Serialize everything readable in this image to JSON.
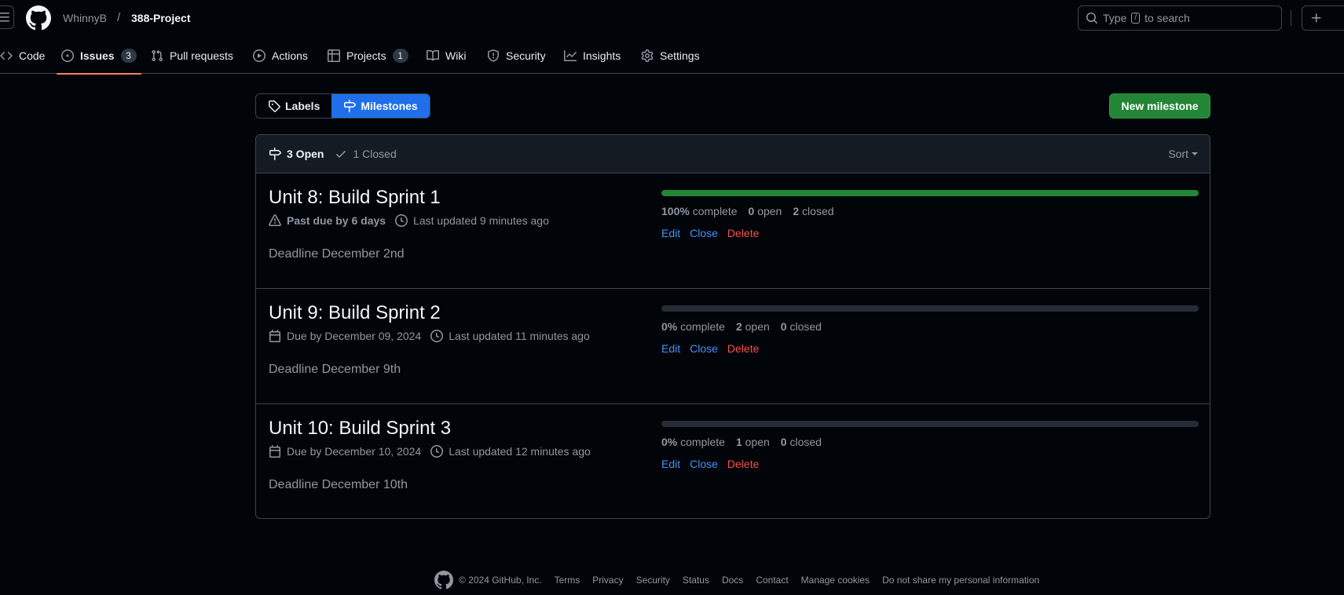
{
  "header": {
    "owner": "WhinnyB",
    "separator": "/",
    "repo": "388-Project",
    "search_placeholder": "Type",
    "search_key": "/",
    "search_suffix": "to search",
    "plus_label": "+"
  },
  "nav": {
    "tabs": [
      {
        "label": "Code",
        "icon": "code-icon"
      },
      {
        "label": "Issues",
        "icon": "issue-opened-icon",
        "counter": "3"
      },
      {
        "label": "Pull requests",
        "icon": "git-pull-request-icon"
      },
      {
        "label": "Actions",
        "icon": "play-icon"
      },
      {
        "label": "Projects",
        "icon": "table-icon",
        "counter": "1"
      },
      {
        "label": "Wiki",
        "icon": "book-icon"
      },
      {
        "label": "Security",
        "icon": "shield-icon"
      },
      {
        "label": "Insights",
        "icon": "graph-icon"
      },
      {
        "label": "Settings",
        "icon": "gear-icon"
      }
    ]
  },
  "subnav": {
    "labels": "Labels",
    "milestones": "Milestones",
    "new_milestone": "New milestone"
  },
  "list": {
    "open_count": "3 Open",
    "closed_count": "1 Closed",
    "sort": "Sort"
  },
  "milestones": [
    {
      "title": "Unit 8: Build Sprint 1",
      "due": "Past due by 6 days",
      "updated": "Last updated 9 minutes ago",
      "description": "Deadline December 2nd",
      "progress": 1.0,
      "percent": "100%",
      "complete_label": "complete",
      "open": "0",
      "open_label": "open",
      "closed": "2",
      "closed_label": "closed"
    },
    {
      "title": "Unit 9: Build Sprint 2",
      "due": "Due by December 09, 2024",
      "updated": "Last updated 11 minutes ago",
      "description": "Deadline December 9th",
      "progress": 0.0,
      "percent": "0%",
      "complete_label": "complete",
      "open": "2",
      "open_label": "open",
      "closed": "0",
      "closed_label": "closed"
    },
    {
      "title": "Unit 10: Build Sprint 3",
      "due": "Due by December 10, 2024",
      "updated": "Last updated 12 minutes ago",
      "description": "Deadline December 10th",
      "progress": 0.0,
      "percent": "0%",
      "complete_label": "complete",
      "open": "1",
      "open_label": "open",
      "closed": "0",
      "closed_label": "closed"
    }
  ],
  "row_actions": {
    "edit": "Edit",
    "close": "Close",
    "delete": "Delete"
  },
  "footer": {
    "copyright": "© 2024 GitHub, Inc.",
    "links": [
      "Terms",
      "Privacy",
      "Security",
      "Status",
      "Docs",
      "Contact",
      "Manage cookies",
      "Do not share my personal information"
    ]
  },
  "colors": {
    "background": "#010409",
    "accent_blue": "#1f6feb",
    "link_blue": "#4493f8",
    "success_green": "#238636",
    "danger_red": "#f85149",
    "tab_underline": "#f78166"
  }
}
